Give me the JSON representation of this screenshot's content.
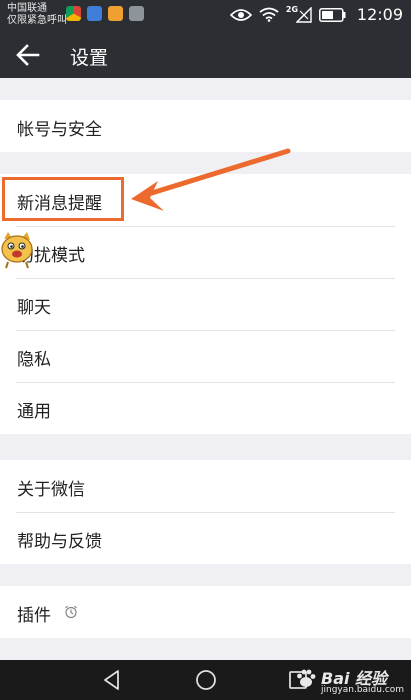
{
  "status_bar": {
    "carrier_line1": "中国联通",
    "carrier_line2": "仅限紧急呼叫",
    "network": "2G",
    "time": "12:09",
    "app_icons": [
      "chrome-icon",
      "weather-icon",
      "notes-icon",
      "gallery-icon"
    ],
    "status_icons": [
      "eye-icon",
      "wifi-icon",
      "signal-icon",
      "battery-icon"
    ]
  },
  "header": {
    "back_icon": "back-arrow-icon",
    "title": "设置"
  },
  "settings": {
    "groups": [
      {
        "items": [
          {
            "label": "帐号与安全"
          }
        ]
      },
      {
        "items": [
          {
            "label": "新消息提醒"
          },
          {
            "label": "勿扰模式"
          },
          {
            "label": "聊天"
          },
          {
            "label": "隐私"
          },
          {
            "label": "通用"
          }
        ]
      },
      {
        "items": [
          {
            "label": "关于微信"
          },
          {
            "label": "帮助与反馈"
          }
        ]
      },
      {
        "items": [
          {
            "label": "插件",
            "icon": "plugin-status-icon"
          }
        ]
      }
    ]
  },
  "annotation": {
    "highlighted_item": "新消息提醒",
    "color": "#ec6a2d"
  },
  "nav_bar": {
    "buttons": [
      "back-triangle-icon",
      "home-circle-icon",
      "recents-square-icon"
    ]
  },
  "watermark": {
    "brand": "Bai 经验",
    "url": "jingyan.baidu.com"
  },
  "colors": {
    "bar_background": "#2b2e33",
    "page_background": "#efeff4",
    "row_background": "#ffffff",
    "nav_background": "#1a1a1a"
  }
}
